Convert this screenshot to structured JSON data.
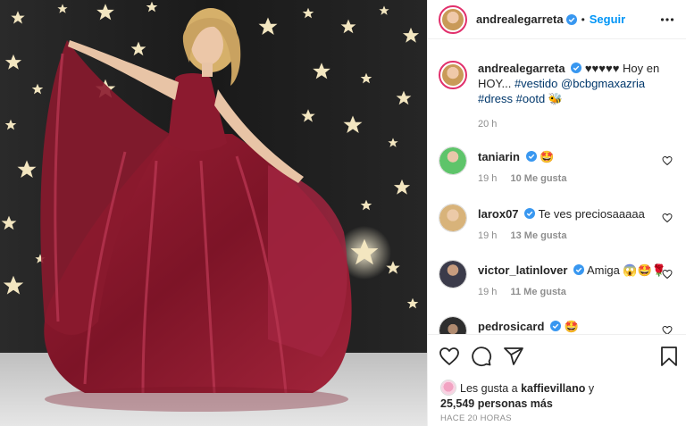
{
  "post": {
    "author": "andrealegarreta",
    "dot": "•",
    "follow_label": "Seguir",
    "caption": {
      "author": "andrealegarreta",
      "text_1": "♥♥♥♥♥ Hoy en HOY... ",
      "tags": [
        "#vestido",
        "@bcbgmaxazria",
        "#dress",
        "#ootd"
      ],
      "emoji": "🐝",
      "time": "20 h"
    }
  },
  "comments": [
    {
      "user": "taniarin",
      "text": "🤩",
      "time": "19 h",
      "likes": "10 Me gusta"
    },
    {
      "user": "larox07",
      "text": "Te ves preciosaaaaa",
      "time": "19 h",
      "likes": "13 Me gusta"
    },
    {
      "user": "victor_latinlover",
      "text": "Amiga 😱🤩🌹",
      "time": "19 h",
      "likes": "11 Me gusta"
    },
    {
      "user": "pedrosicard",
      "text": "🤩",
      "time": "",
      "likes": ""
    }
  ],
  "likes": {
    "prefix": "Les gusta a ",
    "user": "kaffievillano",
    "joiner": " y",
    "count": "25,549 personas más"
  },
  "posted": "HACE 20 HORAS",
  "icons": [
    "heart-icon",
    "comment-icon",
    "share-icon",
    "bookmark-icon",
    "more-icon",
    "verified-icon"
  ],
  "colors": {
    "follow": "#0095f6",
    "verified": "#3897f0",
    "dress": "#8f1a2e",
    "muted": "#8e8e8e"
  }
}
